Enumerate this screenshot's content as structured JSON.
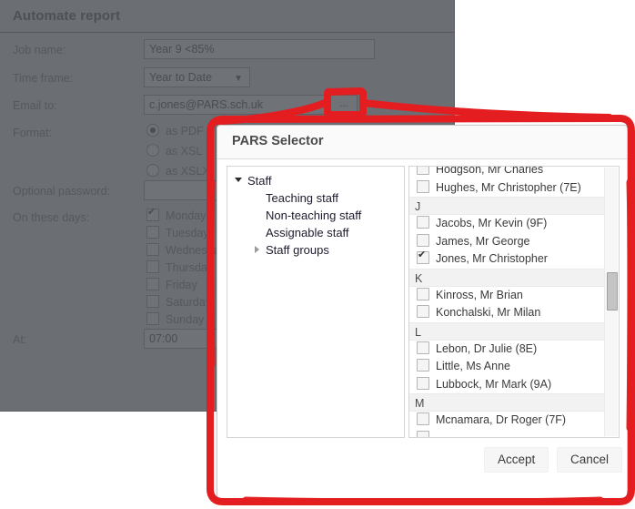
{
  "background_window": {
    "title": "Automate report",
    "fields": {
      "job_name_label": "Job name:",
      "job_name_value": "Year 9 <85%",
      "time_frame_label": "Time frame:",
      "time_frame_value": "Year to Date",
      "email_to_label": "Email to:",
      "email_to_value": "c.jones@PARS.sch.uk",
      "browse_button": "...",
      "format_label": "Format:",
      "optional_password_label": "Optional password:",
      "optional_password_value": "",
      "on_these_days_label": "On these days:",
      "at_label": "At:",
      "at_value": "07:00"
    },
    "format_options": [
      {
        "label": "as PDF",
        "selected": true
      },
      {
        "label": "as XSL",
        "selected": false
      },
      {
        "label": "as XSLX",
        "selected": false
      }
    ],
    "days": [
      {
        "label": "Monday",
        "checked": true
      },
      {
        "label": "Tuesday",
        "checked": false
      },
      {
        "label": "Wednesday",
        "checked": false
      },
      {
        "label": "Thursday",
        "checked": false
      },
      {
        "label": "Friday",
        "checked": false
      },
      {
        "label": "Saturday",
        "checked": false
      },
      {
        "label": "Sunday",
        "checked": false
      }
    ]
  },
  "dialog": {
    "title": "PARS Selector",
    "tree": [
      {
        "label": "Staff",
        "level": "root",
        "expander": "down"
      },
      {
        "label": "Teaching staff",
        "level": "child",
        "expander": "none"
      },
      {
        "label": "Non-teaching staff",
        "level": "child",
        "expander": "none"
      },
      {
        "label": "Assignable staff",
        "level": "child",
        "expander": "none"
      },
      {
        "label": "Staff groups",
        "level": "childgrp",
        "expander": "right"
      }
    ],
    "list": [
      {
        "type": "name",
        "label": "Hodgson, Mr Charles",
        "checked": false
      },
      {
        "type": "name",
        "label": "Hughes, Mr Christopher (7E)",
        "checked": false
      },
      {
        "type": "group",
        "label": "J"
      },
      {
        "type": "name",
        "label": "Jacobs, Mr Kevin (9F)",
        "checked": false
      },
      {
        "type": "name",
        "label": "James, Mr George",
        "checked": false
      },
      {
        "type": "name",
        "label": "Jones, Mr Christopher",
        "checked": true
      },
      {
        "type": "group",
        "label": "K"
      },
      {
        "type": "name",
        "label": "Kinross, Mr Brian",
        "checked": false
      },
      {
        "type": "name",
        "label": "Konchalski, Mr Milan",
        "checked": false
      },
      {
        "type": "group",
        "label": "L"
      },
      {
        "type": "name",
        "label": "Lebon, Dr Julie (8E)",
        "checked": false
      },
      {
        "type": "name",
        "label": "Little, Ms Anne",
        "checked": false
      },
      {
        "type": "name",
        "label": "Lubbock, Mr Mark (9A)",
        "checked": false
      },
      {
        "type": "group",
        "label": "M"
      },
      {
        "type": "name",
        "label": "Mcnamara, Dr Roger (7F)",
        "checked": false
      },
      {
        "type": "name",
        "label": "",
        "checked": false
      }
    ],
    "accept_label": "Accept",
    "cancel_label": "Cancel"
  },
  "colors": {
    "annotation_red": "#e41e20",
    "overlay_gray": "#6b6e73",
    "dialog_white": "#ffffff"
  }
}
